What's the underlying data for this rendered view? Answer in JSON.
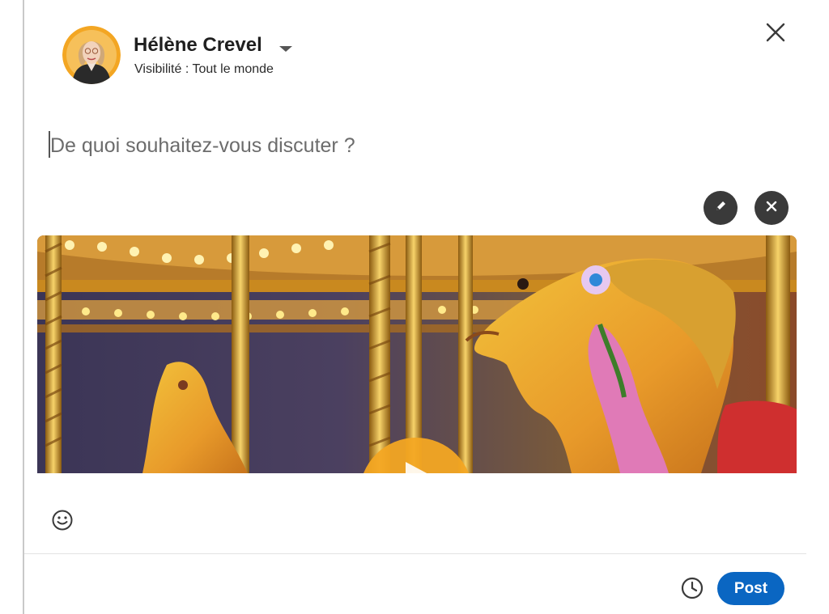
{
  "composer": {
    "author": {
      "name": "Hélène Crevel",
      "visibility": "Visibilité : Tout le monde"
    },
    "input": {
      "placeholder": "De quoi souhaitez-vous discuter ?",
      "value": ""
    },
    "media": {
      "description_icon": "carousel-photo",
      "play_icon": "play-icon"
    },
    "footer": {
      "post_label": "Post"
    }
  },
  "icons": {
    "close": "close-icon",
    "caret": "caret-down-icon",
    "edit": "pencil-icon",
    "remove": "x-icon",
    "emoji": "smiley-icon",
    "schedule": "clock-icon"
  },
  "colors": {
    "primary": "#0a66c2",
    "icon_button_bg": "#3a3a3a",
    "avatar_ring": "#f3a623"
  }
}
